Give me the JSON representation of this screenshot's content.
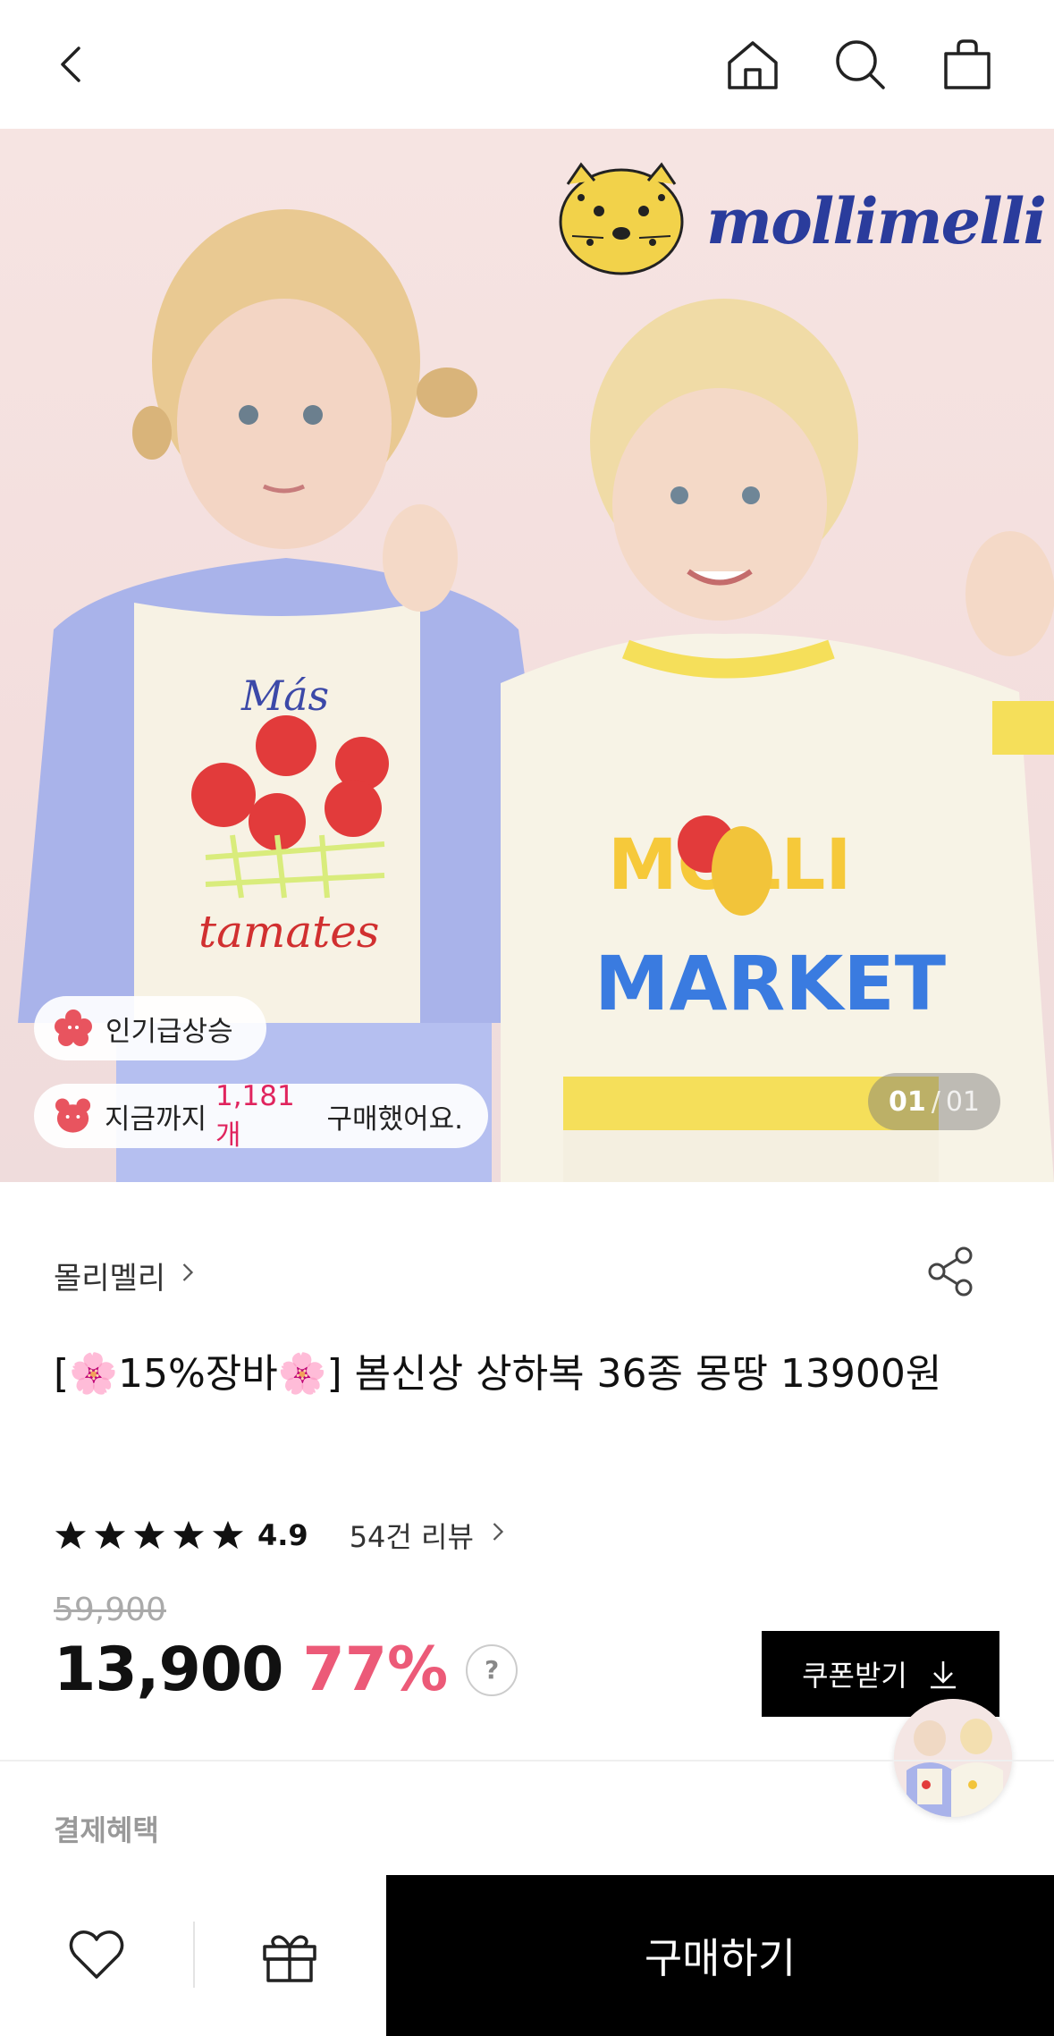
{
  "topbar": {
    "back_icon": "chevron-left-icon",
    "home_icon": "home-icon",
    "search_icon": "search-icon",
    "cart_icon": "shopping-bag-icon"
  },
  "hero": {
    "brand_logo": "mollimelli",
    "badge_popular": "인기급상승",
    "purchase_prefix": "지금까지 ",
    "purchase_count": "1,181개",
    "purchase_suffix": " 구매했어요.",
    "page_current": "01",
    "page_separator": "/",
    "page_total": "01",
    "shirt_text_left_top": "Más",
    "shirt_text_left_bottom": "tamates",
    "shirt_text_right_top": "MOLLI",
    "shirt_text_right_bottom": "MARKET"
  },
  "product": {
    "brand": "몰리멜리",
    "title_prefix": "[",
    "title_flower1": "🌸",
    "title_mid": "15%장바",
    "title_flower2": "🌸",
    "title_suffix": "] 봄신상 상하복 36종 몽땅 13900원",
    "rating": 4.9,
    "rating_label": "4.9",
    "review_count": "54건 리뷰",
    "original_price": "59,900",
    "price": "13,900",
    "discount": "77%",
    "help_label": "?",
    "coupon_label": "쿠폰받기",
    "benefits_label": "결제혜택"
  },
  "bottombar": {
    "wish_icon": "heart-icon",
    "gift_icon": "gift-icon",
    "buy_label": "구매하기"
  },
  "colors": {
    "accent_pink": "#ec5a78",
    "highlight_pink": "#e0245e",
    "black": "#000000",
    "hero_bg": "#f4e2e0"
  }
}
